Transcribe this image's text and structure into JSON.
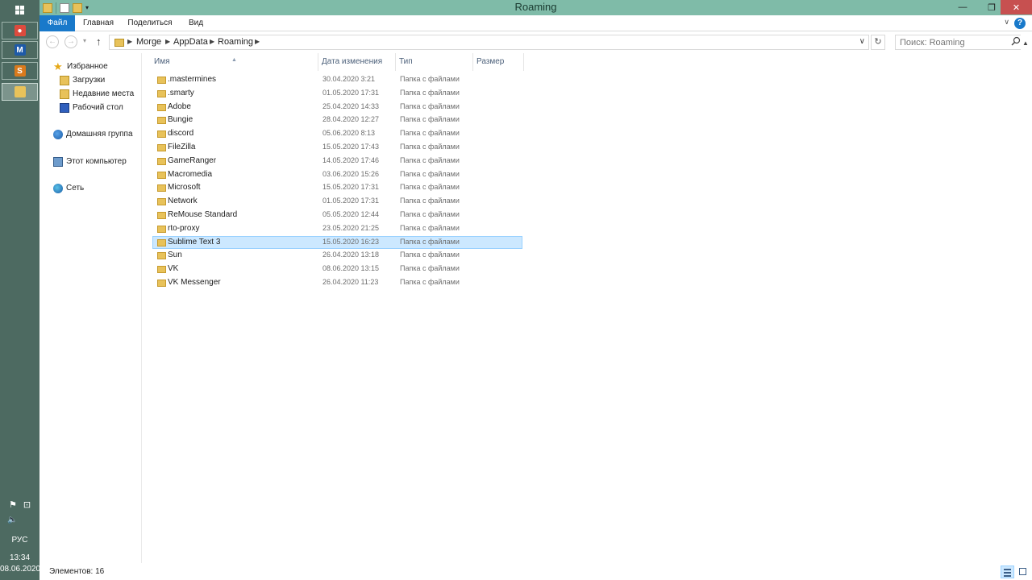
{
  "window": {
    "title": "Roaming",
    "min_glyph": "—",
    "max_glyph": "❐",
    "close_glyph": "✕"
  },
  "ribbon": {
    "tabs": [
      {
        "label": "Файл"
      },
      {
        "label": "Главная"
      },
      {
        "label": "Поделиться"
      },
      {
        "label": "Вид"
      }
    ],
    "help_glyph": "?"
  },
  "address": {
    "breadcrumbs": [
      "Morge",
      "AppData",
      "Roaming"
    ],
    "search_placeholder": "Поиск: Roaming"
  },
  "navigation": {
    "favorites": "Избранное",
    "downloads": "Загрузки",
    "recent": "Недавние места",
    "desktop": "Рабочий стол",
    "homegroup": "Домашняя группа",
    "computer": "Этот компьютер",
    "network": "Сеть"
  },
  "columns": {
    "name": "Имя",
    "date": "Дата изменения",
    "type": "Тип",
    "size": "Размер"
  },
  "files": [
    {
      "name": ".mastermines",
      "date": "30.04.2020 3:21",
      "type": "Папка с файлами"
    },
    {
      "name": ".smarty",
      "date": "01.05.2020 17:31",
      "type": "Папка с файлами"
    },
    {
      "name": "Adobe",
      "date": "25.04.2020 14:33",
      "type": "Папка с файлами"
    },
    {
      "name": "Bungie",
      "date": "28.04.2020 12:27",
      "type": "Папка с файлами"
    },
    {
      "name": "discord",
      "date": "05.06.2020 8:13",
      "type": "Папка с файлами"
    },
    {
      "name": "FileZilla",
      "date": "15.05.2020 17:43",
      "type": "Папка с файлами"
    },
    {
      "name": "GameRanger",
      "date": "14.05.2020 17:46",
      "type": "Папка с файлами"
    },
    {
      "name": "Macromedia",
      "date": "03.06.2020 15:26",
      "type": "Папка с файлами"
    },
    {
      "name": "Microsoft",
      "date": "15.05.2020 17:31",
      "type": "Папка с файлами"
    },
    {
      "name": "Network",
      "date": "01.05.2020 17:31",
      "type": "Папка с файлами"
    },
    {
      "name": "ReMouse Standard",
      "date": "05.05.2020 12:44",
      "type": "Папка с файлами"
    },
    {
      "name": "rto-proxy",
      "date": "23.05.2020 21:25",
      "type": "Папка с файлами"
    },
    {
      "name": "Sublime Text 3",
      "date": "15.05.2020 16:23",
      "type": "Папка с файлами",
      "selected": true
    },
    {
      "name": "Sun",
      "date": "26.04.2020 13:18",
      "type": "Папка с файлами"
    },
    {
      "name": "VK",
      "date": "08.06.2020 13:15",
      "type": "Папка с файлами"
    },
    {
      "name": "VK Messenger",
      "date": "26.04.2020 11:23",
      "type": "Папка с файлами"
    }
  ],
  "status": {
    "items_count": "Элементов: 16"
  },
  "taskbar": {
    "apps": [
      {
        "name": "chrome",
        "color": "#dd4b3e",
        "glyph": "●"
      },
      {
        "name": "maxthon",
        "color": "#1e5aa8",
        "glyph": "M"
      },
      {
        "name": "sublime-text",
        "color": "#d97a1c",
        "glyph": "S"
      },
      {
        "name": "file-explorer",
        "color": "#e8c25a",
        "glyph": ""
      }
    ],
    "language": "РУС",
    "time": "13:34",
    "date": "08.06.2020",
    "flag_glyph": "⚑",
    "net_glyph": "⊡",
    "sound_glyph": "🔈"
  },
  "colors": {
    "accent": "#1979ca",
    "titlebar": "#7fbba8",
    "taskbar": "#4d6a61",
    "selection": "#cce8ff",
    "close": "#c75050"
  }
}
